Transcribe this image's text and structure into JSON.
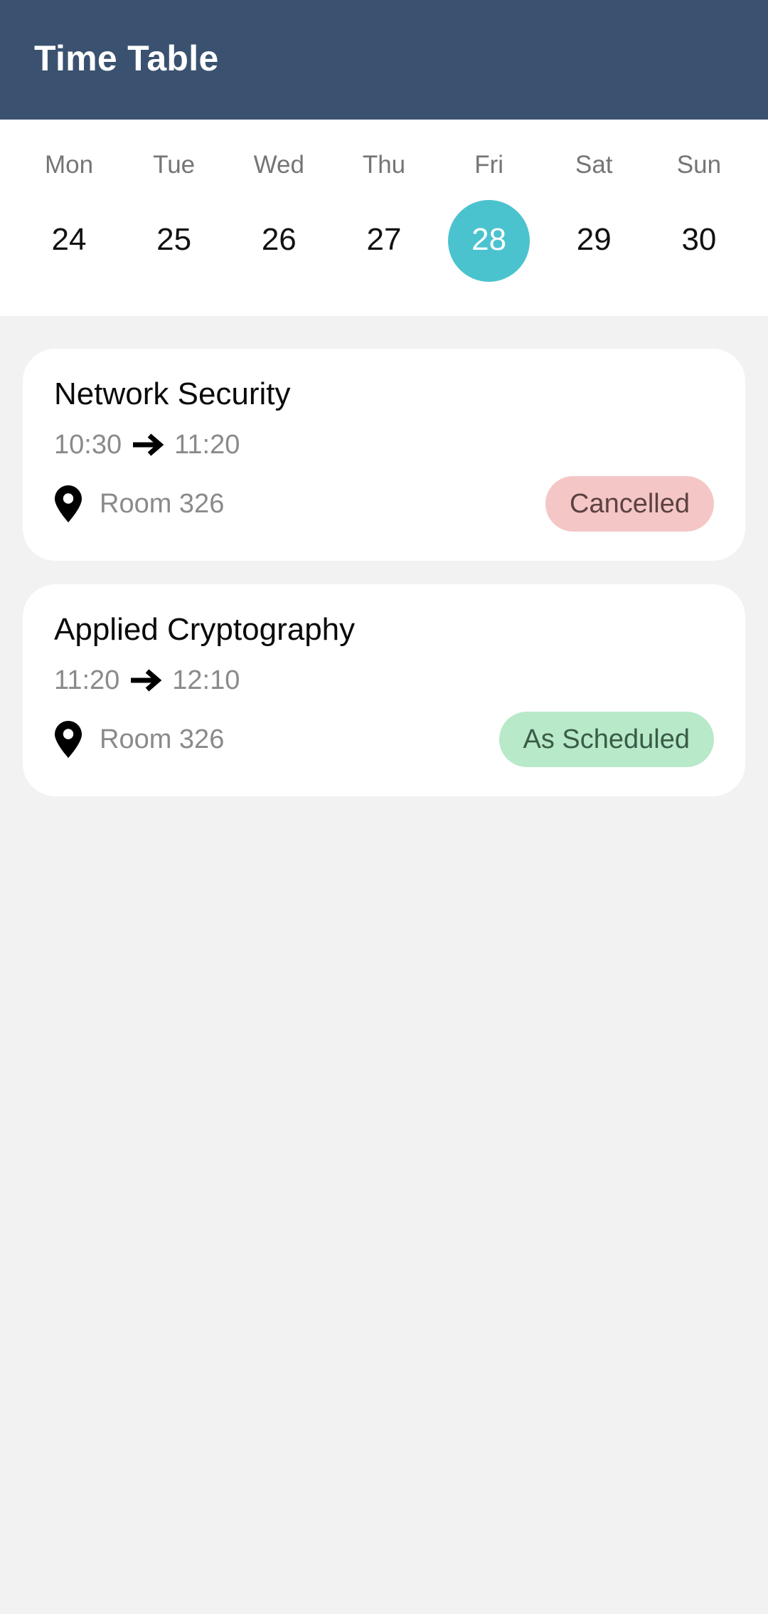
{
  "appbar": {
    "title": "Time Table",
    "background_color": "#3A5270",
    "title_color": "#FFFFFF"
  },
  "week": {
    "selected_index": 4,
    "selected_color": "#4BC3CE",
    "days": [
      {
        "name": "Mon",
        "date": "24",
        "selected": false
      },
      {
        "name": "Tue",
        "date": "25",
        "selected": false
      },
      {
        "name": "Wed",
        "date": "26",
        "selected": false
      },
      {
        "name": "Thu",
        "date": "27",
        "selected": false
      },
      {
        "name": "Fri",
        "date": "28",
        "selected": true
      },
      {
        "name": "Sat",
        "date": "29",
        "selected": false
      },
      {
        "name": "Sun",
        "date": "30",
        "selected": false
      }
    ]
  },
  "schedule": {
    "background_color": "#F2F2F2",
    "classes": [
      {
        "title": "Network Security",
        "start_time": "10:30",
        "arrow": "arrow-right-icon",
        "end_time": "11:20",
        "location_icon": "location-pin-icon",
        "room": "Room 326",
        "status": "Cancelled",
        "status_type": "cancelled",
        "status_bg": "#F5C6C6",
        "status_fg": "#5C4242"
      },
      {
        "title": "Applied Cryptography",
        "start_time": "11:20",
        "arrow": "arrow-right-icon",
        "end_time": "12:10",
        "location_icon": "location-pin-icon",
        "room": "Room 326",
        "status": "As Scheduled",
        "status_type": "scheduled",
        "status_bg": "#B8E9C9",
        "status_fg": "#3A5C47"
      }
    ]
  }
}
